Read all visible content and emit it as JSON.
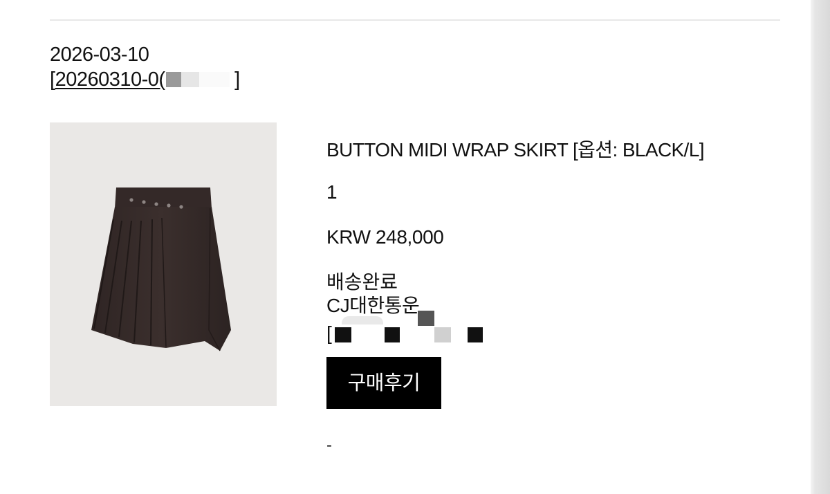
{
  "order": {
    "date": "2026-03-10",
    "number_prefix": "20260310-0(",
    "bracket_open": "[",
    "bracket_close": "]"
  },
  "product": {
    "image_icon": "skirt-photo",
    "name": "BUTTON MIDI WRAP SKIRT [옵션: BLACK/L]",
    "quantity": "1",
    "price": "KRW 248,000"
  },
  "shipping": {
    "status": "배송완료",
    "courier": "CJ대한통운",
    "tracking_prefix": "["
  },
  "actions": {
    "review_button": "구매후기"
  },
  "footer": {
    "dash": "-"
  },
  "colors": {
    "button_bg": "#000000",
    "button_text": "#ffffff",
    "image_bg": "#eae8e6",
    "skirt": "#3a2e2c"
  }
}
